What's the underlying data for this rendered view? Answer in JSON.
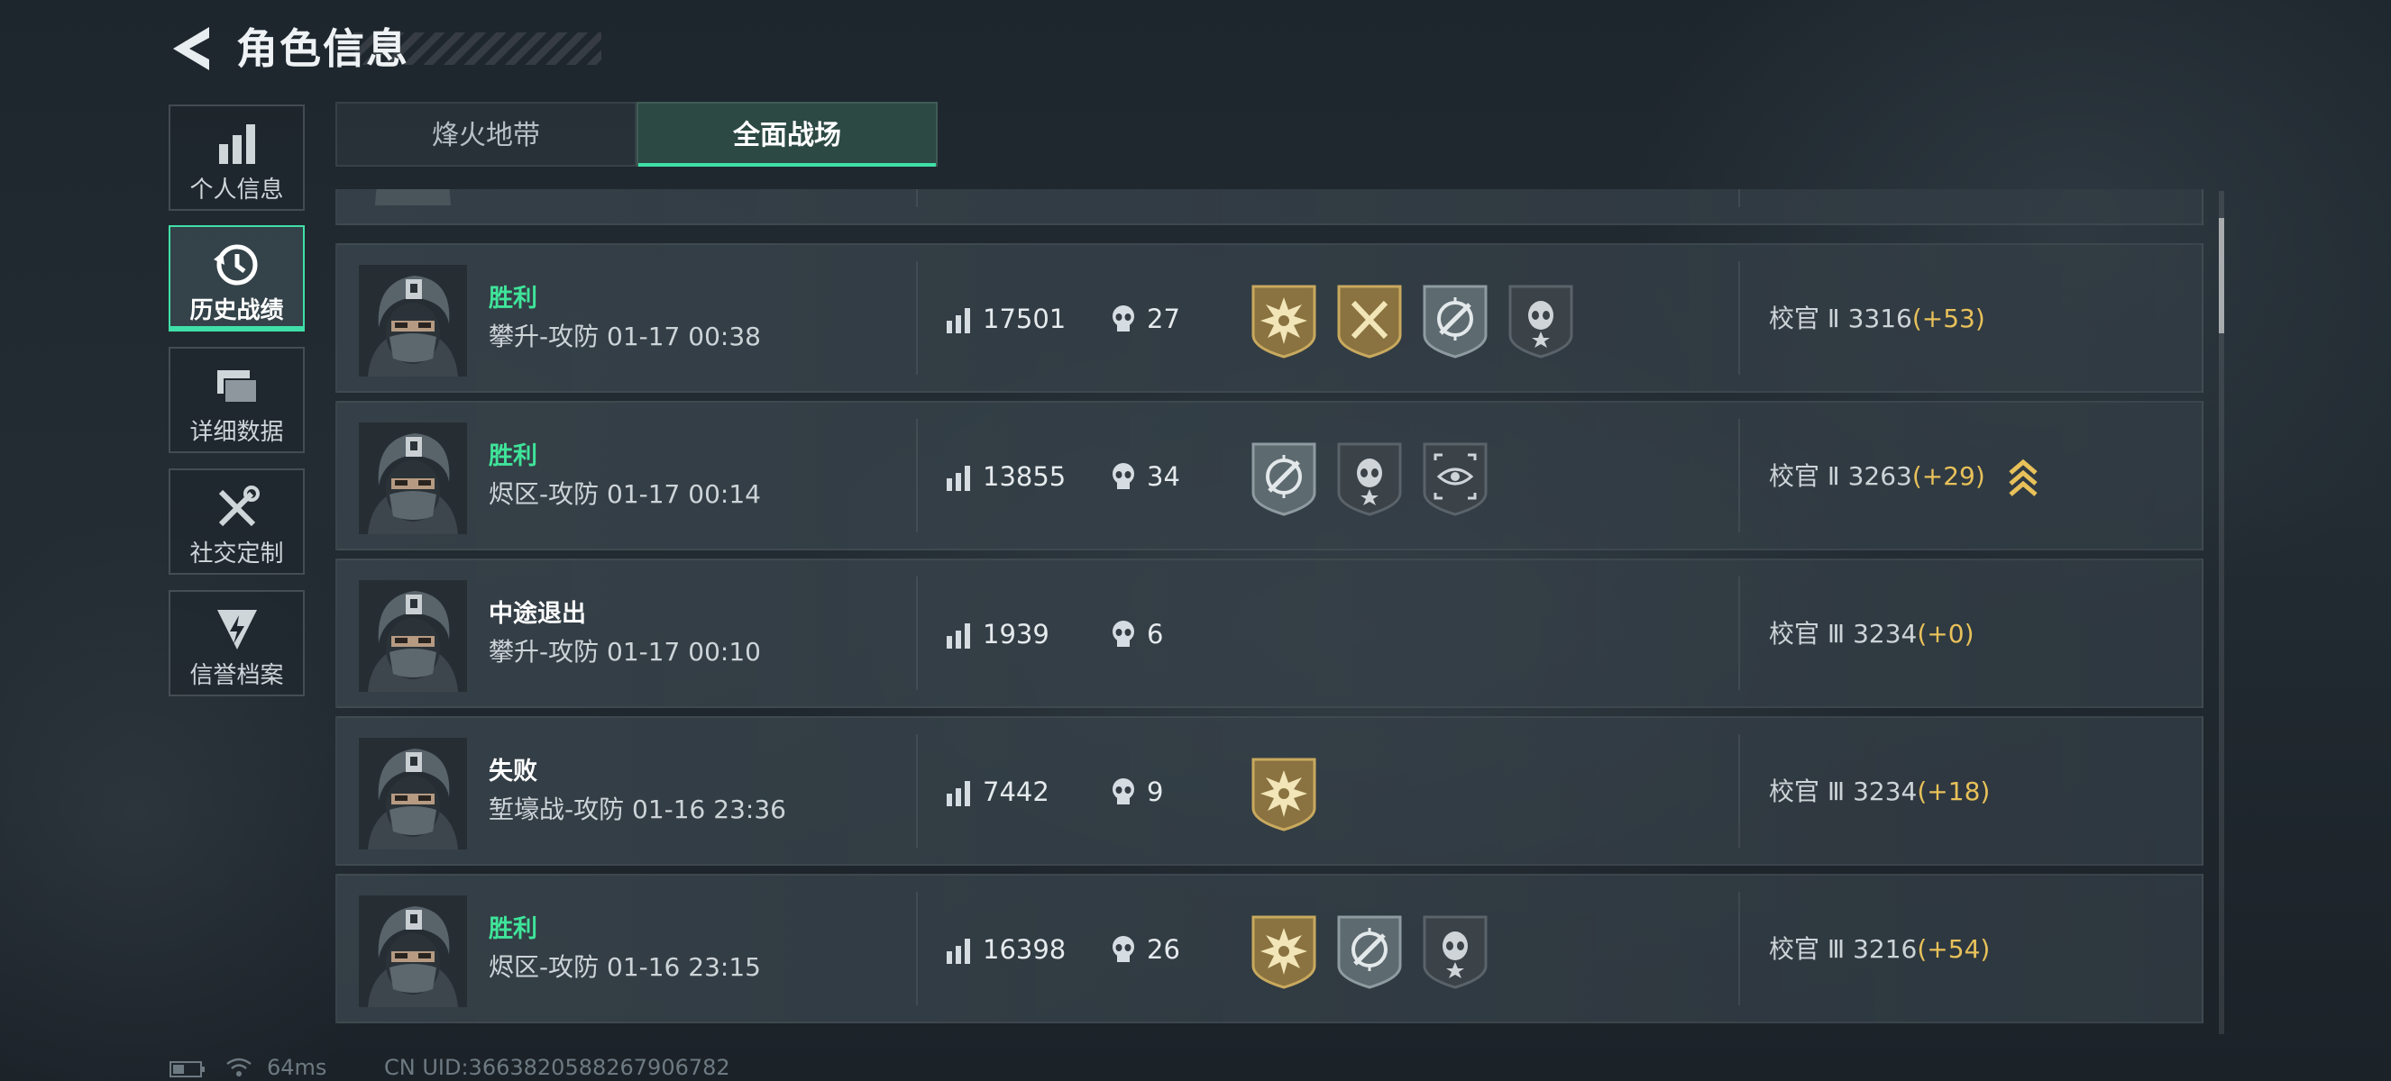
{
  "header": {
    "title": "角色信息"
  },
  "sidebar": {
    "items": [
      {
        "label": "个人信息",
        "icon": "bar-chart-icon"
      },
      {
        "label": "历史战绩",
        "icon": "clock-history-icon",
        "active": true
      },
      {
        "label": "详细数据",
        "icon": "cards-icon"
      },
      {
        "label": "社交定制",
        "icon": "tools-icon"
      },
      {
        "label": "信誉档案",
        "icon": "shield-bolt-icon"
      }
    ]
  },
  "tabs": [
    {
      "label": "烽火地带",
      "active": false
    },
    {
      "label": "全面战场",
      "active": true
    }
  ],
  "matches": [
    {
      "result": "胜利",
      "result_type": "win",
      "mode_time": "攀升-攻防 01-17 00:38",
      "score": "17501",
      "kills": "27",
      "badges": [
        "gold-explosion-badge-icon",
        "gold-tools-badge-icon",
        "silver-crosshair-rifle-badge-icon",
        "dark-skull-star-badge-icon"
      ],
      "rank_label": "校官 Ⅱ 3316",
      "rank_delta": "(+53)",
      "promoted": false
    },
    {
      "result": "胜利",
      "result_type": "win",
      "mode_time": "烬区-攻防 01-17 00:14",
      "score": "13855",
      "kills": "34",
      "badges": [
        "silver-crosshair-rifle-badge-icon",
        "dark-skull-star-badge-icon",
        "dark-eye-target-badge-icon"
      ],
      "rank_label": "校官 Ⅱ 3263",
      "rank_delta": "(+29)",
      "promoted": true
    },
    {
      "result": "中途退出",
      "result_type": "neutral",
      "mode_time": "攀升-攻防 01-17 00:10",
      "score": "1939",
      "kills": "6",
      "badges": [],
      "rank_label": "校官 Ⅲ 3234",
      "rank_delta": "(+0)",
      "promoted": false
    },
    {
      "result": "失败",
      "result_type": "neutral",
      "mode_time": "堑壕战-攻防 01-16 23:36",
      "score": "7442",
      "kills": "9",
      "badges": [
        "gold-explosion-badge-icon"
      ],
      "rank_label": "校官 Ⅲ 3234",
      "rank_delta": "(+18)",
      "promoted": false
    },
    {
      "result": "胜利",
      "result_type": "win",
      "mode_time": "烬区-攻防 01-16 23:15",
      "score": "16398",
      "kills": "26",
      "badges": [
        "gold-explosion-badge-icon",
        "silver-crosshair-rifle-badge-icon",
        "dark-skull-star-badge-icon"
      ],
      "rank_label": "校官 Ⅲ 3216",
      "rank_delta": "(+54)",
      "promoted": false
    }
  ],
  "status_bar": {
    "ping": "64ms",
    "uid": "CN UID:3663820588267906782"
  },
  "colors": {
    "accent": "#3fe0a8",
    "win": "#3fe49a",
    "delta": "#e8c15a"
  }
}
